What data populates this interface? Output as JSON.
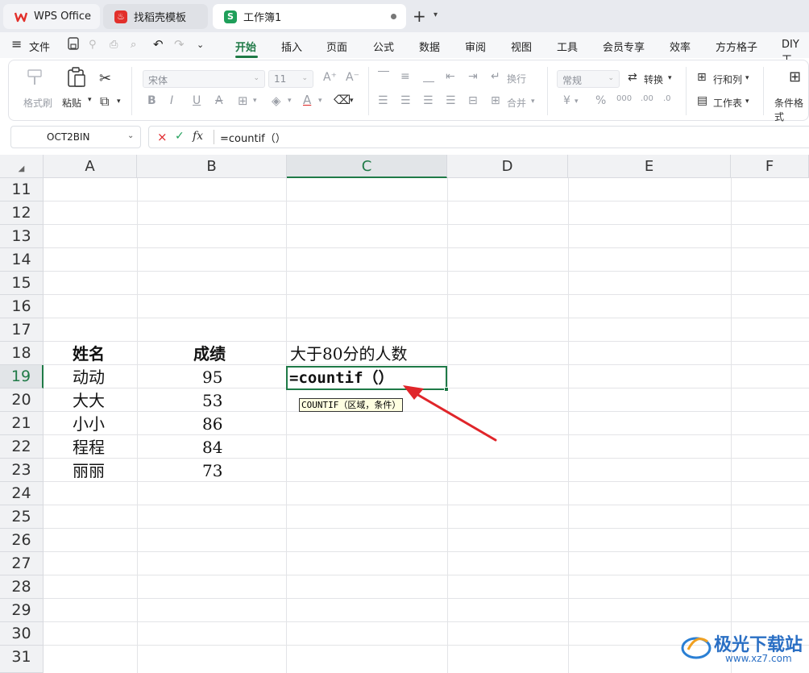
{
  "tabs": {
    "wps": "WPS Office",
    "templates": "找稻壳模板",
    "workbook": "工作簿1",
    "new_tab": "+"
  },
  "menu": {
    "file": "文件",
    "items": [
      "开始",
      "插入",
      "页面",
      "公式",
      "数据",
      "审阅",
      "视图",
      "工具",
      "会员专享",
      "效率",
      "方方格子",
      "DIY工"
    ]
  },
  "ribbon": {
    "format_painter": "格式刷",
    "paste": "粘贴",
    "font_name": "宋体",
    "font_size": "11",
    "wrap": "换行",
    "merge": "合并",
    "number_format": "常规",
    "convert": "转换",
    "rows_cols": "行和列",
    "worksheet": "工作表",
    "conditional_format": "条件格式",
    "currency": "¥",
    "percent": "%"
  },
  "formula_bar": {
    "name_box": "OCT2BIN",
    "cancel": "×",
    "confirm": "✓",
    "fx": "fx",
    "formula": "=countif（）"
  },
  "grid": {
    "columns": [
      "A",
      "B",
      "C",
      "D",
      "E",
      "F"
    ],
    "rows": [
      "11",
      "12",
      "13",
      "14",
      "15",
      "16",
      "17",
      "18",
      "19",
      "20",
      "21",
      "22",
      "23",
      "24",
      "25",
      "26",
      "27",
      "28",
      "29",
      "30",
      "31"
    ],
    "selected_column": "C",
    "selected_row": "19",
    "header_name": "姓名",
    "header_score": "成绩",
    "header_count": "大于80分的人数",
    "names": [
      "动动",
      "大大",
      "小小",
      "程程",
      "丽丽"
    ],
    "scores": [
      "95",
      "53",
      "86",
      "84",
      "73"
    ],
    "editing_formula": "=countif（）",
    "tooltip": "COUNTIF（区域，条件）"
  },
  "watermark": {
    "text": "极光下载站",
    "url": "www.xz7.com"
  },
  "colors": {
    "accent": "#1f7a47",
    "arrow": "#e0252a"
  }
}
